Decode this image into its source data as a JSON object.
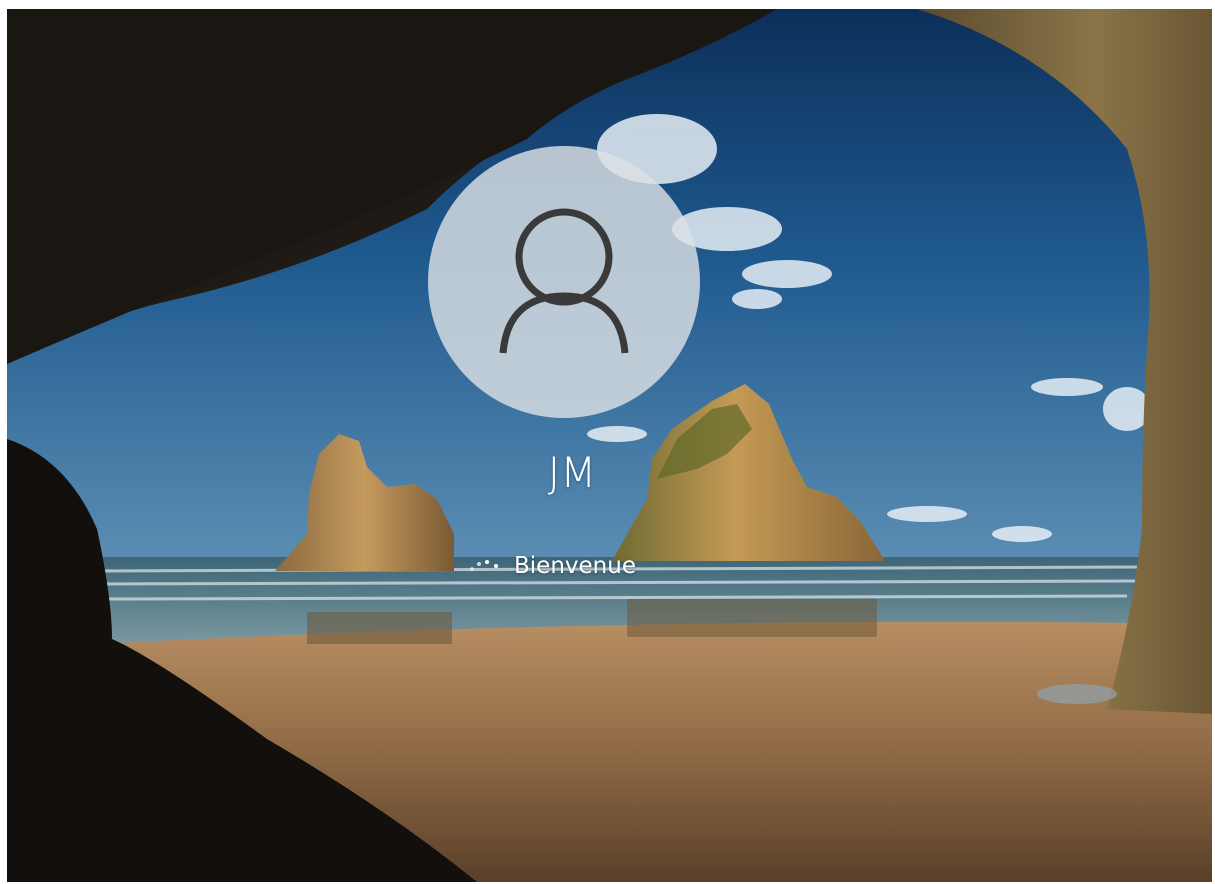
{
  "lock_screen": {
    "background": "beach-cave-wallpaper",
    "account": {
      "avatar_icon": "person-icon",
      "name": "JM"
    },
    "status": {
      "icon": "loading-dots-icon",
      "text": "Bienvenue"
    }
  }
}
